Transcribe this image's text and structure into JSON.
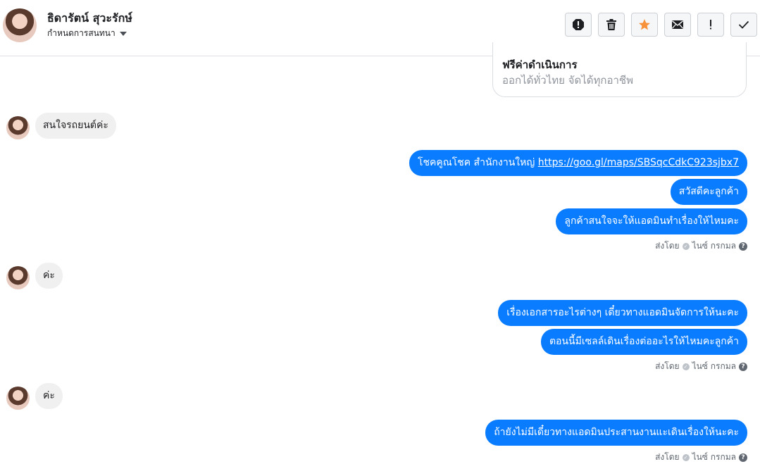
{
  "header": {
    "name": "ธิดารัตน์ สุวะรักษ์",
    "subtitle": "กำหนดการสนทนา"
  },
  "toolbar": {
    "icons": [
      "spam-icon",
      "trash-icon",
      "star-icon",
      "mail-icon",
      "important-icon",
      "check-icon"
    ],
    "star_color": "#f7923a"
  },
  "card": {
    "title": "ฟรีค่าดำเนินการ",
    "subtitle": "ออกได้ทั่วไทย จัดได้ทุกอาชีพ"
  },
  "messages": {
    "in_1": "สนใจรถยนต์ค่ะ",
    "out_1_prefix": "โชคคูณโชค สำนักงานใหญ่ ",
    "out_1_link": "https://goo.gl/maps/SBSqcCdkC923sjbx7",
    "out_2": "สวัสดีคะลูกค้า",
    "out_3": "ลูกค้าสนใจจะให้แอดมินทำเรื่องให้ไหมคะ",
    "in_2": "ค่ะ",
    "out_4": "เรื่องเอกสารอะไรต่างๆ เดี๋ยวทางแอดมินจัดการให้นะคะ",
    "out_5": "ตอนนี้มีเซลล์เดินเรื่องต่ออะไรให้ไหมคะลูกค้า",
    "in_3": "ค่ะ",
    "out_6": "ถ้ายังไม่มีเดี๋ยวทางแอดมินประสานงานแะเดินเรื่องให้นะคะ"
  },
  "sent_by": {
    "label": "ส่งโดย",
    "sender": "ไนซ์ กรกมล",
    "help": "?"
  },
  "colors": {
    "outgoing_bubble": "#0a7cff",
    "incoming_bubble": "#f1f0f0"
  }
}
